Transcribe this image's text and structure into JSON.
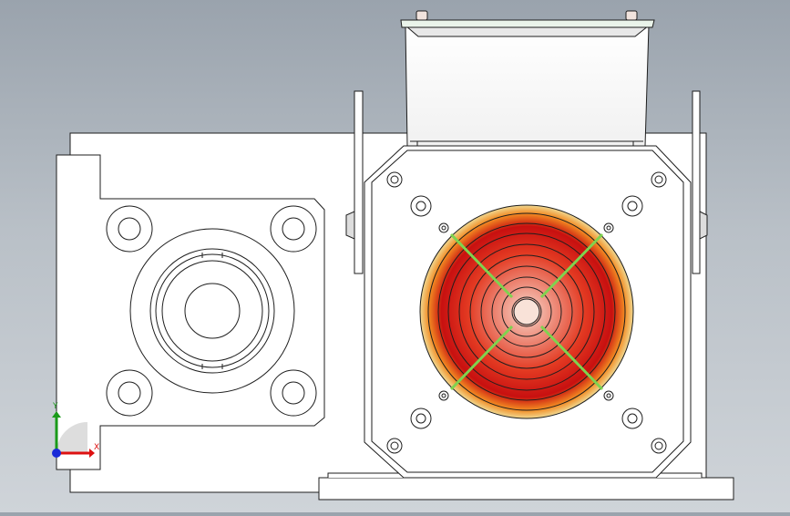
{
  "viewport": {
    "background_top": "#9aa3ad",
    "background_bottom": "#cfd4d9",
    "part_fill": "#ffffff",
    "edge_color": "#1e1e1e"
  },
  "triad": {
    "x_label": "X",
    "y_label": "Y",
    "x_color": "#dd1111",
    "y_color": "#1a9a1a",
    "z_color": "#1a2ad8"
  },
  "fan": {
    "ring_colors": [
      "#e8c070",
      "#f07a1a",
      "#e8281a",
      "#c01010",
      "#f7d2c2"
    ],
    "guard_color": "#7fd34f"
  }
}
